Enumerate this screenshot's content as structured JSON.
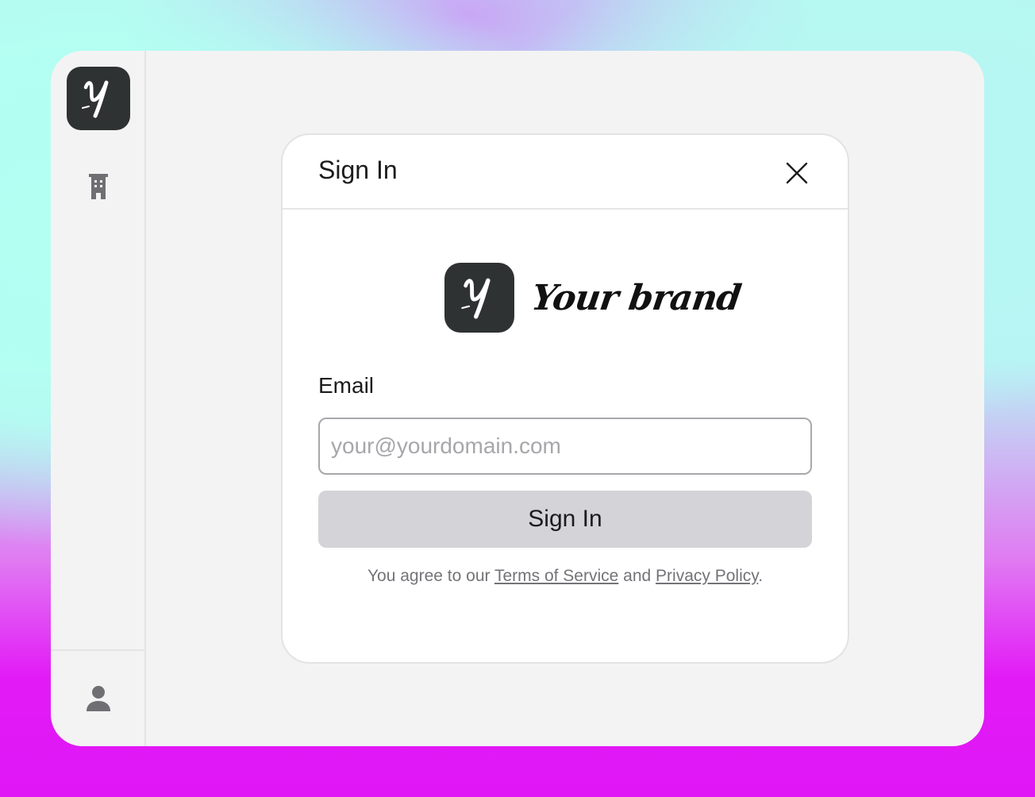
{
  "colors": {
    "app_background": "#f3f3f3",
    "logo_background": "#2f3233",
    "button_background": "#d4d4d8",
    "icon_color": "#6f6f73"
  },
  "sidebar": {
    "logo_letter": "Y",
    "items": [
      {
        "icon": "building-icon"
      }
    ],
    "footer_icon": "user-icon"
  },
  "modal": {
    "title": "Sign In",
    "close_icon": "close-icon",
    "brand": {
      "letter": "Y",
      "name": "Your brand"
    },
    "email_label": "Email",
    "email_placeholder": "your@yourdomain.com",
    "email_value": "",
    "submit_label": "Sign In",
    "legal": {
      "prefix": "You agree to our ",
      "terms": "Terms of Service",
      "middle": " and ",
      "privacy": "Privacy Policy",
      "suffix": "."
    }
  }
}
